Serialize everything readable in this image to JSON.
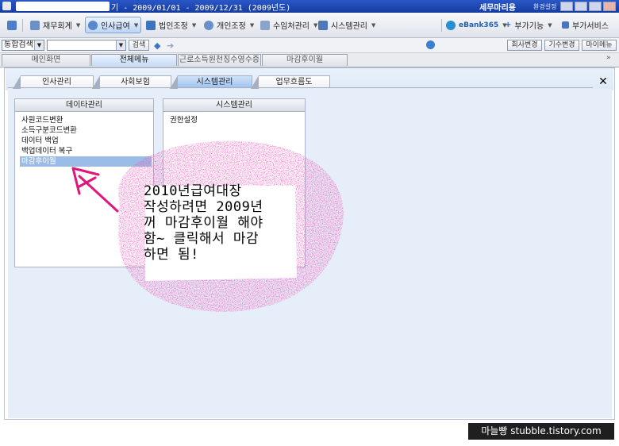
{
  "window": {
    "title": "기 - 2009/01/01 - 2009/12/31 (2009년도)",
    "company": "세무마리용",
    "environment_label": "환경설정"
  },
  "toolbar": {
    "items": [
      {
        "label": "재무회계"
      },
      {
        "label": "인사급여"
      },
      {
        "label": "법인조정"
      },
      {
        "label": "개인조정"
      },
      {
        "label": "수임처관리"
      },
      {
        "label": "시스템관리"
      }
    ],
    "bank_logo": "eBank365",
    "extra_label": "부가기능",
    "service_label": "부가서비스"
  },
  "searchbar": {
    "scope_value": "통합검색",
    "query_value": "",
    "search_button": "검색",
    "right_buttons": [
      "회사변경",
      "기수변경",
      "마이메뉴"
    ]
  },
  "page_tabs": [
    "메인화면",
    "전체메뉴",
    "근로소득원천징수영수증",
    "마감후이월"
  ],
  "sub_tabs": [
    "인사관리",
    "사회보험",
    "시스템관리",
    "업무흐름도"
  ],
  "panels": {
    "data": {
      "title": "데이타관리",
      "items": [
        "사원코드변환",
        "소득구분코드변환",
        "데이터 백업",
        "백업데이터 복구",
        "마감후이월"
      ]
    },
    "system": {
      "title": "시스템관리",
      "items": [
        "권한설정"
      ]
    }
  },
  "annotation": {
    "text": "2010년급여대장\n작성하려면 2009년\n꺼 마감후이월 해야\n함~ 클릭해서 마감\n하면 됨!"
  },
  "watermark": "마늘빵 stubble.tistory.com",
  "colors": {
    "titlebar": "#1f4ab5",
    "active_tab": "#9fc2ef",
    "selected_item": "#9bbce6",
    "scribble": "#e0167a"
  }
}
